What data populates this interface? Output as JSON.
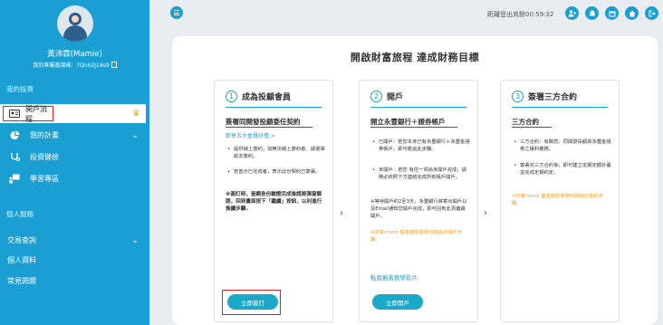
{
  "user": {
    "name": "黃沛霖(Mamie)",
    "ref_code": "我的專屬邀請碼：7Qn62J1As9"
  },
  "sidebar": {
    "section1": "我的投資",
    "items": [
      {
        "label": "開戶流程",
        "icon": "id-card-icon",
        "active": true,
        "badge": "crown-icon"
      },
      {
        "label": "我的計畫",
        "icon": "pie-chart-icon",
        "chevron": "chevron-down-icon"
      },
      {
        "label": "投資健檢",
        "icon": "stethoscope-icon"
      },
      {
        "label": "學習專區",
        "icon": "presenter-icon"
      }
    ],
    "section2": "個人服務",
    "items2": [
      {
        "label": "交易查詢",
        "chevron": "chevron-down-icon"
      },
      {
        "label": "個人資料"
      },
      {
        "label": "常見問題"
      }
    ]
  },
  "topbar": {
    "countdown": "距離登出尚餘00:59:32",
    "icons": [
      "user-plus-icon",
      "bell-icon",
      "calendar-icon",
      "home-icon",
      "logout-icon"
    ]
  },
  "main": {
    "title": "開啟財富旅程 達成財務目標",
    "steps": [
      {
        "num": "1",
        "title": "成為投顧會員",
        "sub": "簽署同開發投顧委任契約",
        "link": "即享五大會員好禮 >",
        "bullets": [
          "提供線上簽約，如無法線上簽約者，請選擇紙本簽約。",
          "若曾示已完成者，表示此份契約已簽署。"
        ],
        "note": "※簽訂時，釜網身份驗證完成後請將彈窗關閉，回到畫面按下「繼續」按鈕，以利進行後續步驟。",
        "button": "立即簽訂"
      },
      {
        "num": "2",
        "title": "開戶",
        "sub": "開立永豐銀行＋證券帳戶",
        "bullets": [
          "已開戶：若您本身已有永豐銀行＋永豐金證券帳戶，即可跳過此步驟。",
          "未開戶：若您 有任一項尚未開戶完成，請務必依照下方連結完成所有帳戶開戶。"
        ],
        "note": "※等待開戶約2至3天，永豐銀行將寄出開戶以及Email通知您開戶完成，即可回到此頁繼續開戶。",
        "orange": "※好享check 基金健檢服務可跳過此開戶步驟。",
        "video": "點我觀看教學影片",
        "button": "立即開戶"
      },
      {
        "num": "3",
        "title": "簽署三方合約",
        "sub": "三方合約",
        "bullets": [
          "三方合約：有關您、同開發投顧與永豐金證券之權利義務。",
          "簽署完三方合約後，即可建立定期定額計畫並完成定期約定。"
        ],
        "orange": "※好享check 基金健檢服務可跳過此簽約步驟。"
      }
    ]
  },
  "colors": {
    "primary": "#1b9fd3",
    "button": "#1ca8c8",
    "highlight": "#e0201b",
    "accent": "#f0a020"
  }
}
